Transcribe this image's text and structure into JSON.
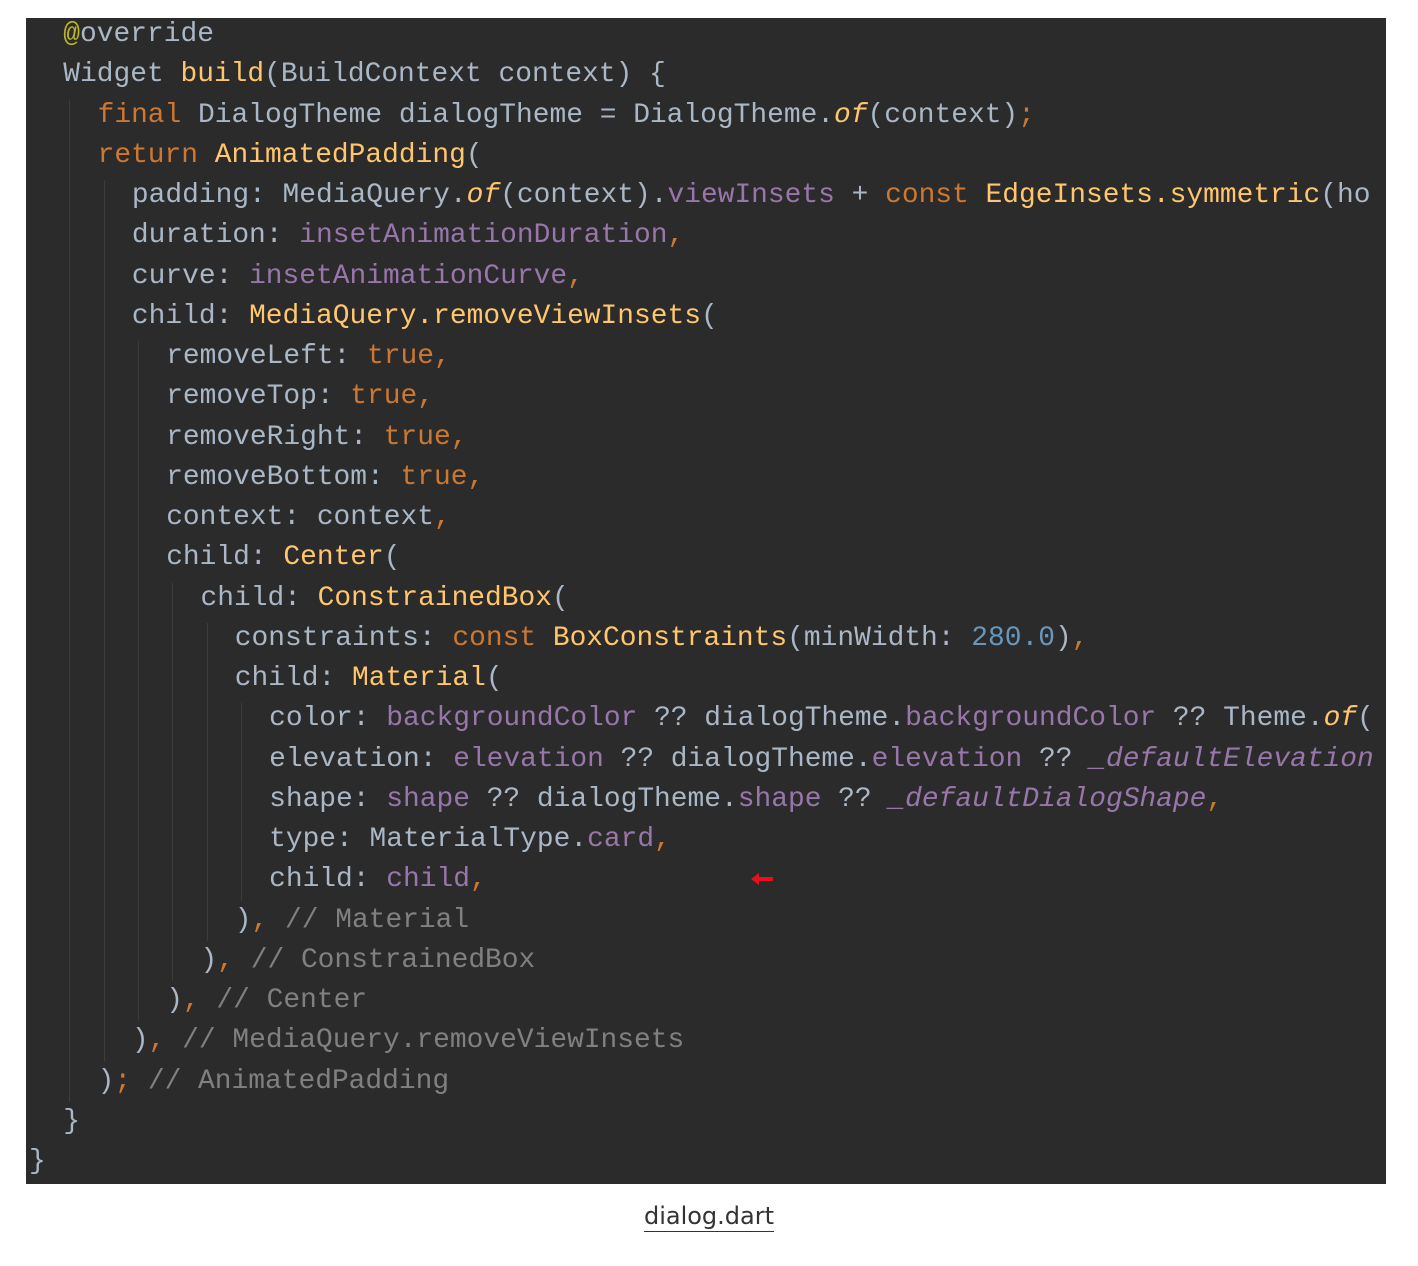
{
  "caption": {
    "link_text": "dialog.dart"
  },
  "colors": {
    "editor_background": "#2b2b2b",
    "keyword": "#cc7832",
    "function": "#ffc66d",
    "field": "#9876aa",
    "number": "#6897bb",
    "comment": "#808080",
    "annotation": "#bbb529",
    "default_text": "#a9b7c6",
    "marker_arrow": "#e8101e"
  },
  "code_lines": [
    {
      "indent": 1,
      "tokens": [
        {
          "t": "@",
          "c": "tok-annot"
        },
        {
          "t": "override",
          "c": "tok-text"
        }
      ]
    },
    {
      "indent": 1,
      "tokens": [
        {
          "t": "Widget ",
          "c": "tok-text"
        },
        {
          "t": "build",
          "c": "tok-fn"
        },
        {
          "t": "(BuildContext context) {",
          "c": "tok-text"
        }
      ]
    },
    {
      "indent": 2,
      "tokens": [
        {
          "t": "final ",
          "c": "tok-kw"
        },
        {
          "t": "DialogTheme dialogTheme = DialogTheme.",
          "c": "tok-text"
        },
        {
          "t": "of",
          "c": "tok-italic-fn"
        },
        {
          "t": "(context)",
          "c": "tok-text"
        },
        {
          "t": ";",
          "c": "tok-kw"
        }
      ]
    },
    {
      "indent": 2,
      "tokens": [
        {
          "t": "return ",
          "c": "tok-kw"
        },
        {
          "t": "AnimatedPadding",
          "c": "tok-fn"
        },
        {
          "t": "(",
          "c": "tok-text"
        }
      ]
    },
    {
      "indent": 3,
      "tokens": [
        {
          "t": "padding: MediaQuery.",
          "c": "tok-text"
        },
        {
          "t": "of",
          "c": "tok-italic-fn"
        },
        {
          "t": "(context).",
          "c": "tok-text"
        },
        {
          "t": "viewInsets",
          "c": "tok-field"
        },
        {
          "t": " + ",
          "c": "tok-text"
        },
        {
          "t": "const ",
          "c": "tok-kw"
        },
        {
          "t": "EdgeInsets.symmetric",
          "c": "tok-fn"
        },
        {
          "t": "(ho",
          "c": "tok-text"
        }
      ]
    },
    {
      "indent": 3,
      "tokens": [
        {
          "t": "duration: ",
          "c": "tok-text"
        },
        {
          "t": "insetAnimationDuration",
          "c": "tok-field"
        },
        {
          "t": ",",
          "c": "tok-kw"
        }
      ]
    },
    {
      "indent": 3,
      "tokens": [
        {
          "t": "curve: ",
          "c": "tok-text"
        },
        {
          "t": "insetAnimationCurve",
          "c": "tok-field"
        },
        {
          "t": ",",
          "c": "tok-kw"
        }
      ]
    },
    {
      "indent": 3,
      "tokens": [
        {
          "t": "child: ",
          "c": "tok-text"
        },
        {
          "t": "MediaQuery.removeViewInsets",
          "c": "tok-fn"
        },
        {
          "t": "(",
          "c": "tok-text"
        }
      ]
    },
    {
      "indent": 4,
      "tokens": [
        {
          "t": "removeLeft: ",
          "c": "tok-text"
        },
        {
          "t": "true",
          "c": "tok-kw"
        },
        {
          "t": ",",
          "c": "tok-kw"
        }
      ]
    },
    {
      "indent": 4,
      "tokens": [
        {
          "t": "removeTop: ",
          "c": "tok-text"
        },
        {
          "t": "true",
          "c": "tok-kw"
        },
        {
          "t": ",",
          "c": "tok-kw"
        }
      ]
    },
    {
      "indent": 4,
      "tokens": [
        {
          "t": "removeRight: ",
          "c": "tok-text"
        },
        {
          "t": "true",
          "c": "tok-kw"
        },
        {
          "t": ",",
          "c": "tok-kw"
        }
      ]
    },
    {
      "indent": 4,
      "tokens": [
        {
          "t": "removeBottom: ",
          "c": "tok-text"
        },
        {
          "t": "true",
          "c": "tok-kw"
        },
        {
          "t": ",",
          "c": "tok-kw"
        }
      ]
    },
    {
      "indent": 4,
      "tokens": [
        {
          "t": "context: context",
          "c": "tok-text"
        },
        {
          "t": ",",
          "c": "tok-kw"
        }
      ]
    },
    {
      "indent": 4,
      "tokens": [
        {
          "t": "child: ",
          "c": "tok-text"
        },
        {
          "t": "Center",
          "c": "tok-fn"
        },
        {
          "t": "(",
          "c": "tok-text"
        }
      ]
    },
    {
      "indent": 5,
      "tokens": [
        {
          "t": "child: ",
          "c": "tok-text"
        },
        {
          "t": "ConstrainedBox",
          "c": "tok-fn"
        },
        {
          "t": "(",
          "c": "tok-text"
        }
      ]
    },
    {
      "indent": 6,
      "tokens": [
        {
          "t": "constraints: ",
          "c": "tok-text"
        },
        {
          "t": "const ",
          "c": "tok-kw"
        },
        {
          "t": "BoxConstraints",
          "c": "tok-fn"
        },
        {
          "t": "(minWidth: ",
          "c": "tok-text"
        },
        {
          "t": "280.0",
          "c": "tok-num"
        },
        {
          "t": ")",
          "c": "tok-text"
        },
        {
          "t": ",",
          "c": "tok-kw"
        }
      ]
    },
    {
      "indent": 6,
      "tokens": [
        {
          "t": "child: ",
          "c": "tok-text"
        },
        {
          "t": "Material",
          "c": "tok-fn"
        },
        {
          "t": "(",
          "c": "tok-text"
        }
      ]
    },
    {
      "indent": 7,
      "tokens": [
        {
          "t": "color: ",
          "c": "tok-text"
        },
        {
          "t": "backgroundColor",
          "c": "tok-field"
        },
        {
          "t": " ?? dialogTheme.",
          "c": "tok-text"
        },
        {
          "t": "backgroundColor",
          "c": "tok-field"
        },
        {
          "t": " ?? Theme.",
          "c": "tok-text"
        },
        {
          "t": "of",
          "c": "tok-italic-fn"
        },
        {
          "t": "(",
          "c": "tok-text"
        }
      ]
    },
    {
      "indent": 7,
      "tokens": [
        {
          "t": "elevation: ",
          "c": "tok-text"
        },
        {
          "t": "elevation",
          "c": "tok-field"
        },
        {
          "t": " ?? dialogTheme.",
          "c": "tok-text"
        },
        {
          "t": "elevation",
          "c": "tok-field"
        },
        {
          "t": " ?? ",
          "c": "tok-text"
        },
        {
          "t": "_defaultElevation",
          "c": "tok-field-italic"
        }
      ]
    },
    {
      "indent": 7,
      "tokens": [
        {
          "t": "shape: ",
          "c": "tok-text"
        },
        {
          "t": "shape",
          "c": "tok-field"
        },
        {
          "t": " ?? dialogTheme.",
          "c": "tok-text"
        },
        {
          "t": "shape",
          "c": "tok-field"
        },
        {
          "t": " ?? ",
          "c": "tok-text"
        },
        {
          "t": "_defaultDialogShape",
          "c": "tok-field-italic"
        },
        {
          "t": ",",
          "c": "tok-kw"
        }
      ]
    },
    {
      "indent": 7,
      "tokens": [
        {
          "t": "type: MaterialType.",
          "c": "tok-text"
        },
        {
          "t": "card",
          "c": "tok-field"
        },
        {
          "t": ",",
          "c": "tok-kw"
        }
      ]
    },
    {
      "indent": 7,
      "tokens": [
        {
          "t": "child: ",
          "c": "tok-text"
        },
        {
          "t": "child",
          "c": "tok-field"
        },
        {
          "t": ",",
          "c": "tok-kw"
        }
      ]
    },
    {
      "indent": 6,
      "tokens": [
        {
          "t": ")",
          "c": "tok-text"
        },
        {
          "t": ",",
          "c": "tok-kw"
        },
        {
          "t": " // Material",
          "c": "tok-comment"
        }
      ]
    },
    {
      "indent": 5,
      "tokens": [
        {
          "t": ")",
          "c": "tok-text"
        },
        {
          "t": ",",
          "c": "tok-kw"
        },
        {
          "t": " // ConstrainedBox",
          "c": "tok-comment"
        }
      ]
    },
    {
      "indent": 4,
      "tokens": [
        {
          "t": ")",
          "c": "tok-text"
        },
        {
          "t": ",",
          "c": "tok-kw"
        },
        {
          "t": " // Center",
          "c": "tok-comment"
        }
      ]
    },
    {
      "indent": 3,
      "tokens": [
        {
          "t": ")",
          "c": "tok-text"
        },
        {
          "t": ",",
          "c": "tok-kw"
        },
        {
          "t": " // MediaQuery.removeViewInsets",
          "c": "tok-comment"
        }
      ]
    },
    {
      "indent": 2,
      "tokens": [
        {
          "t": ")",
          "c": "tok-text"
        },
        {
          "t": ";",
          "c": "tok-kw"
        },
        {
          "t": " // AnimatedPadding",
          "c": "tok-comment"
        }
      ]
    },
    {
      "indent": 1,
      "tokens": [
        {
          "t": "}",
          "c": "tok-text"
        }
      ]
    },
    {
      "indent": 0,
      "tokens": [
        {
          "t": "}",
          "c": "tok-text"
        }
      ]
    }
  ],
  "marker": {
    "icon": "red-arrow-left-icon",
    "line_index": 21
  }
}
